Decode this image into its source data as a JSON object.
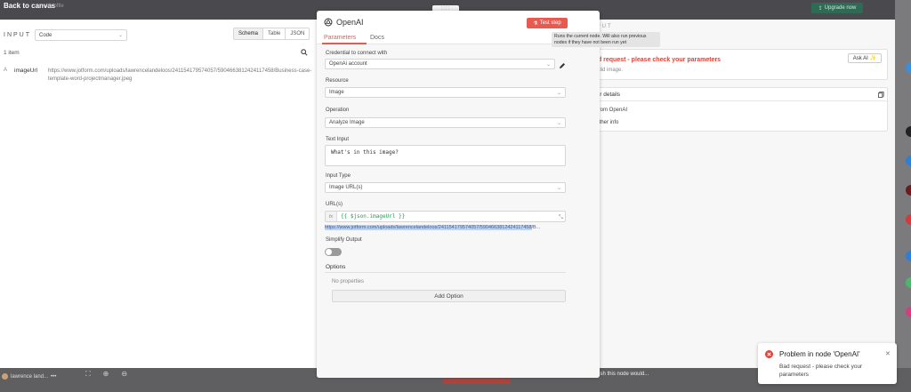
{
  "topbar": {
    "back_label": "Back to canvas",
    "back_sub": "ab oftle",
    "upgrade_label": "Upgrade now",
    "drag_handle": "::::"
  },
  "input_panel": {
    "label": "INPUT",
    "mode_value": "Code",
    "view_tabs": [
      "Schema",
      "Table",
      "JSON"
    ],
    "items_count": "1 item",
    "row": {
      "type": "A",
      "field": "imageUrl",
      "value": "https://www.jotform.com/uploads/lawrencelandeloos/241154179574057/5904663812424117458/Business-case-template-word-projectmanager.jpeg"
    }
  },
  "node": {
    "title": "OpenAI",
    "test_button": "Test step",
    "tabs": [
      "Parameters",
      "Docs"
    ],
    "tooltip": "Runs the current node. Will also run previous nodes if they have not been run yet",
    "credential_label": "Credential to connect with",
    "credential_value": "OpenAi account",
    "resource_label": "Resource",
    "resource_value": "Image",
    "operation_label": "Operation",
    "operation_value": "Analyze Image",
    "text_input_label": "Text Input",
    "text_input_value": "What's in this image?",
    "input_type_label": "Input Type",
    "input_type_value": "Image URL(s)",
    "urls_label": "URL(s)",
    "fx_label": "fx",
    "urls_expression": "{{ $json.imageUrl }}",
    "url_preview_selected": "https://www.jotform.com/uploads/lawrencelandeloos/241154179574057/5904663812424117458",
    "url_preview_rest": "/B...",
    "simplify_label": "Simplify Output",
    "options_label": "Options",
    "no_properties": "No properties",
    "add_option": "Add Option"
  },
  "output_panel": {
    "label": "OUTPUT",
    "error_title": "Bad request - please check your parameters",
    "error_sub": "Invalid image.",
    "ask_ai": "Ask AI",
    "details_title": "Error details",
    "details_items": [
      "From OpenAI",
      "Other info"
    ]
  },
  "bottombar": {
    "user_name": "lawrence land...",
    "user_more": "•••",
    "wish_text": "I wish this node would..."
  },
  "toast": {
    "title": "Problem in node 'OpenAI'",
    "message": "Bad request - please check your parameters"
  },
  "colors": {
    "accent": "#e85a4f",
    "error": "#d9453a",
    "expression": "#2a9a5c",
    "upgrade": "#2f6a55"
  }
}
